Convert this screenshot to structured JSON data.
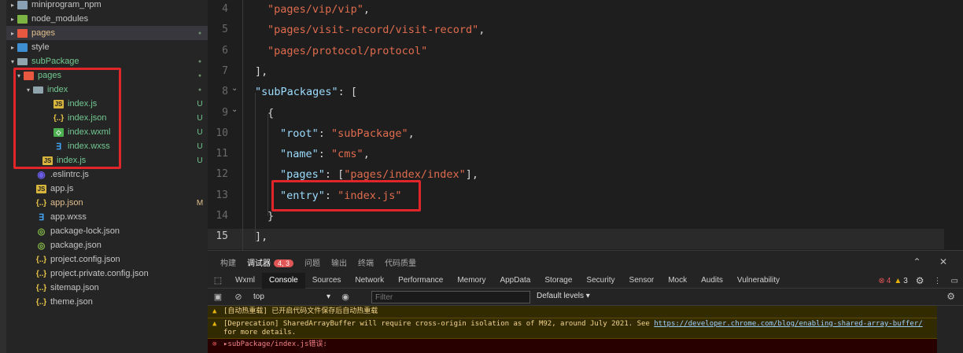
{
  "explorer": {
    "items": [
      {
        "label": "miniprogram_npm",
        "icon": "folder-icon",
        "twisty": "▸",
        "badge": ""
      },
      {
        "label": "node_modules",
        "icon": "folder-green-icon",
        "twisty": "▸",
        "badge": ""
      },
      {
        "label": "pages",
        "icon": "folder-red-icon",
        "twisty": "▸",
        "badge": "●"
      },
      {
        "label": "style",
        "icon": "folder-blue-icon",
        "twisty": "▸",
        "badge": ""
      },
      {
        "label": "subPackage",
        "icon": "folder-open-icon",
        "twisty": "▾",
        "badge": "●"
      },
      {
        "label": "pages",
        "icon": "folder-red-icon",
        "twisty": "▾",
        "badge": "●"
      },
      {
        "label": "index",
        "icon": "folder-open-icon",
        "twisty": "▾",
        "badge": "●"
      },
      {
        "label": "index.js",
        "icon": "js-file-icon",
        "twisty": "",
        "badge": "U"
      },
      {
        "label": "index.json",
        "icon": "json-file-icon",
        "twisty": "",
        "badge": "U"
      },
      {
        "label": "index.wxml",
        "icon": "wxml-file-icon",
        "twisty": "",
        "badge": "U"
      },
      {
        "label": "index.wxss",
        "icon": "wxss-file-icon",
        "twisty": "",
        "badge": "U"
      },
      {
        "label": "index.js",
        "icon": "js-file-icon",
        "twisty": "",
        "badge": "U"
      },
      {
        "label": ".eslintrc.js",
        "icon": "eslint-file-icon",
        "twisty": "",
        "badge": ""
      },
      {
        "label": "app.js",
        "icon": "js-file-icon",
        "twisty": "",
        "badge": ""
      },
      {
        "label": "app.json",
        "icon": "json-file-icon",
        "twisty": "",
        "badge": "M"
      },
      {
        "label": "app.wxss",
        "icon": "wxss-file-icon",
        "twisty": "",
        "badge": ""
      },
      {
        "label": "package-lock.json",
        "icon": "npm-file-icon",
        "twisty": "",
        "badge": ""
      },
      {
        "label": "package.json",
        "icon": "npm-file-icon",
        "twisty": "",
        "badge": ""
      },
      {
        "label": "project.config.json",
        "icon": "json-file-icon",
        "twisty": "",
        "badge": ""
      },
      {
        "label": "project.private.config.json",
        "icon": "json-file-icon",
        "twisty": "",
        "badge": ""
      },
      {
        "label": "sitemap.json",
        "icon": "json-file-icon",
        "twisty": "",
        "badge": ""
      },
      {
        "label": "theme.json",
        "icon": "json-file-icon",
        "twisty": "",
        "badge": ""
      }
    ]
  },
  "editor": {
    "line_numbers": [
      "4",
      "5",
      "6",
      "7",
      "8",
      "9",
      "10",
      "11",
      "12",
      "13",
      "14",
      "15"
    ],
    "current_line": "15",
    "lines": [
      {
        "tokens": [
          {
            "t": "\"pages/vip/vip\"",
            "c": "str"
          },
          {
            "t": ",",
            "c": ""
          }
        ]
      },
      {
        "tokens": [
          {
            "t": "\"pages/visit-record/visit-record\"",
            "c": "str"
          },
          {
            "t": ",",
            "c": ""
          }
        ]
      },
      {
        "tokens": [
          {
            "t": "\"pages/protocol/protocol\"",
            "c": "str"
          }
        ]
      },
      {
        "tokens": [
          {
            "t": "],",
            "c": ""
          }
        ]
      },
      {
        "tokens": [
          {
            "t": "\"subPackages\"",
            "c": "key"
          },
          {
            "t": ": [",
            "c": ""
          }
        ]
      },
      {
        "tokens": [
          {
            "t": "{",
            "c": ""
          }
        ]
      },
      {
        "tokens": [
          {
            "t": "\"root\"",
            "c": "key"
          },
          {
            "t": ": ",
            "c": ""
          },
          {
            "t": "\"subPackage\"",
            "c": "str"
          },
          {
            "t": ",",
            "c": ""
          }
        ]
      },
      {
        "tokens": [
          {
            "t": "\"name\"",
            "c": "key"
          },
          {
            "t": ": ",
            "c": ""
          },
          {
            "t": "\"cms\"",
            "c": "str"
          },
          {
            "t": ",",
            "c": ""
          }
        ]
      },
      {
        "tokens": [
          {
            "t": "\"pages\"",
            "c": "key"
          },
          {
            "t": ": [",
            "c": ""
          },
          {
            "t": "\"pages/index/index\"",
            "c": "str"
          },
          {
            "t": "],",
            "c": ""
          }
        ]
      },
      {
        "tokens": [
          {
            "t": "\"entry\"",
            "c": "key"
          },
          {
            "t": ": ",
            "c": ""
          },
          {
            "t": "\"index.js\"",
            "c": "str"
          }
        ]
      },
      {
        "tokens": [
          {
            "t": "}",
            "c": ""
          }
        ]
      },
      {
        "tokens": [
          {
            "t": "],",
            "c": ""
          }
        ]
      }
    ]
  },
  "panel": {
    "tabs": [
      "构建",
      "调试器",
      "问题",
      "输出",
      "终端",
      "代码质量"
    ],
    "active_tab": "调试器",
    "debugger_badge": "4, 3",
    "controls": {
      "collapse": "⌃",
      "close": "✕"
    }
  },
  "devtools": {
    "tabs": [
      "Wxml",
      "Console",
      "Sources",
      "Network",
      "Performance",
      "Memory",
      "AppData",
      "Storage",
      "Security",
      "Sensor",
      "Mock",
      "Audits",
      "Vulnerability"
    ],
    "active_tab": "Console",
    "error_count": "4",
    "warning_count": "3"
  },
  "console": {
    "context": "top",
    "filter_placeholder": "Filter",
    "levels": "Default levels ▾",
    "messages": [
      {
        "type": "warning",
        "text": "[自动热重载] 已开启代码文件保存后自动热重载"
      },
      {
        "type": "warning",
        "text": "[Deprecation] SharedArrayBuffer will require cross-origin isolation as of M92, around July 2021. See ",
        "link": "https://developer.chrome.com/blog/enabling-shared-array-buffer/",
        "suffix": " for more details."
      },
      {
        "type": "error",
        "text": "▸subPackage/index.js错误:"
      }
    ]
  },
  "colors": {
    "highlight_box": "#e0262b",
    "string": "#e06c4e",
    "key": "#9cdcfe"
  }
}
